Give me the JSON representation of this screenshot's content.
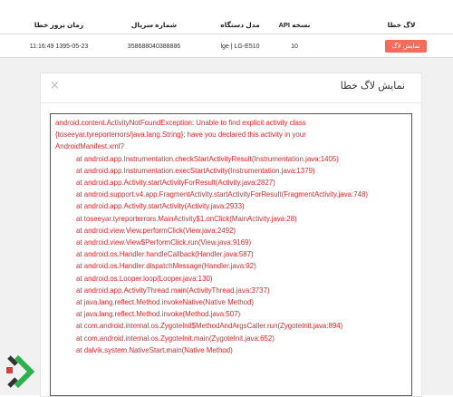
{
  "table": {
    "headers": {
      "log": "لاگ خطا",
      "api": "نسخه API",
      "model": "مدل دستگاه",
      "serial": "شماره سریال",
      "time": "زمان بروز خطا"
    },
    "row": {
      "log_button": "نمایش لاگ",
      "api": "10",
      "model": "lge | LG-E510",
      "serial": "358688040388886",
      "time": "11:16:49 1395-05-23"
    }
  },
  "modal": {
    "title": "نمایش لاگ خطا",
    "close": "×",
    "log_lines": [
      {
        "kind": "head",
        "text": "android.content.ActivityNotFoundException: Unable to find explicit activity class"
      },
      {
        "kind": "head",
        "text": "{toseeyar.tyreporterrors/java.lang.String}; have you declared this activity in your"
      },
      {
        "kind": "head",
        "text": "AndroidManifest.xml?"
      },
      {
        "kind": "trace",
        "text": "at android.app.Instrumentation.checkStartActivityResult(Instrumentation.java:1405)"
      },
      {
        "kind": "trace",
        "text": "at android.app.Instrumentation.execStartActivity(Instrumentation.java:1379)"
      },
      {
        "kind": "trace",
        "text": "at android.app.Activity.startActivityForResult(Activity.java:2827)"
      },
      {
        "kind": "trace",
        "text": "at android.support.v4.app.FragmentActivity.startActivityForResult(FragmentActivity.java:748)"
      },
      {
        "kind": "trace",
        "text": "at android.app.Activity.startActivity(Activity.java:2933)"
      },
      {
        "kind": "trace",
        "text": "at toseeyar.tyreporterrors.MainActivity$1.onClick(MainActivity.java:28)"
      },
      {
        "kind": "trace",
        "text": "at android.view.View.performClick(View.java:2492)"
      },
      {
        "kind": "trace",
        "text": "at android.view.View$PerformClick.run(View.java:9169)"
      },
      {
        "kind": "trace",
        "text": "at android.os.Handler.handleCallback(Handler.java:587)"
      },
      {
        "kind": "trace",
        "text": "at android.os.Handler.dispatchMessage(Handler.java:92)"
      },
      {
        "kind": "trace",
        "text": "at android.os.Looper.loop(Looper.java:130)"
      },
      {
        "kind": "trace",
        "text": "at android.app.ActivityThread.main(ActivityThread.java:3737)"
      },
      {
        "kind": "trace",
        "text": "at java.lang.reflect.Method.invokeNative(Native Method)"
      },
      {
        "kind": "trace",
        "text": "at java.lang.reflect.Method.invoke(Method.java:507)"
      },
      {
        "kind": "trace",
        "text": "at com.android.internal.os.ZygoteInit$MethodAndArgsCaller.run(ZygoteInit.java:894)"
      },
      {
        "kind": "trace",
        "text": "at com.android.internal.os.ZygoteInit.main(ZygoteInit.java:652)"
      },
      {
        "kind": "trace",
        "text": "at dalvik.system.NativeStart.main(Native Method)"
      }
    ]
  },
  "colors": {
    "accent_button": "#f26b5b",
    "log_text": "#e0282a",
    "logo_green": "#2bb24c",
    "logo_red": "#e53935",
    "logo_dark": "#333333"
  },
  "logo": {
    "icon": "brand-chevron-logo"
  }
}
